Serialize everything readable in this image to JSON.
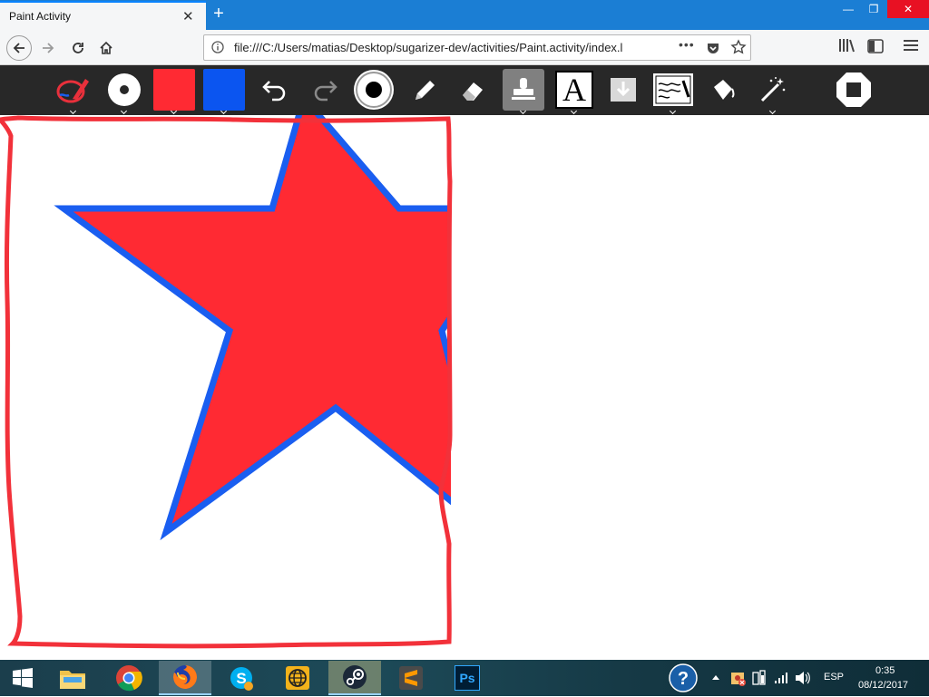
{
  "browser": {
    "tab_title": "Paint Activity",
    "tab_close": "✕",
    "new_tab": "+",
    "url": "file:///C:/Users/matias/Desktop/sugarizer-dev/activities/Paint.activity/index.l",
    "url_more": "•••",
    "window_min": "—",
    "window_max": "❐",
    "window_close": "✕"
  },
  "toolbar": {
    "tools": [
      {
        "name": "activity",
        "icon": "paint-activity-icon"
      },
      {
        "name": "size",
        "icon": "brush-size-icon"
      },
      {
        "name": "fill-color",
        "icon": "color-swatch-icon",
        "color": "#ff2a33"
      },
      {
        "name": "stroke-color",
        "icon": "color-swatch-icon",
        "color": "#0b55f0"
      },
      {
        "name": "undo",
        "icon": "undo-icon"
      },
      {
        "name": "redo",
        "icon": "redo-icon"
      },
      {
        "name": "brush",
        "icon": "brush-icon"
      },
      {
        "name": "pencil",
        "icon": "pencil-icon"
      },
      {
        "name": "eraser",
        "icon": "eraser-icon"
      },
      {
        "name": "stamp",
        "icon": "stamp-icon"
      },
      {
        "name": "text",
        "icon": "text-icon",
        "label": "A"
      },
      {
        "name": "insert-image",
        "icon": "insert-image-icon"
      },
      {
        "name": "background",
        "icon": "background-icon"
      },
      {
        "name": "bucket",
        "icon": "bucket-icon"
      },
      {
        "name": "filters",
        "icon": "magic-wand-icon"
      },
      {
        "name": "stop",
        "icon": "stop-icon"
      }
    ]
  },
  "canvas": {
    "border_color": "#f2313a",
    "star_fill": "#ff2a33",
    "star_stroke": "#1a5ef0"
  },
  "taskbar": {
    "apps": [
      {
        "name": "file-explorer",
        "icon": "folder-icon"
      },
      {
        "name": "chrome",
        "icon": "chrome-icon"
      },
      {
        "name": "firefox",
        "icon": "firefox-icon"
      },
      {
        "name": "skype",
        "icon": "skype-icon"
      },
      {
        "name": "globe",
        "icon": "globe-icon"
      },
      {
        "name": "steam",
        "icon": "steam-icon"
      },
      {
        "name": "sublime",
        "icon": "sublime-icon"
      },
      {
        "name": "photoshop",
        "icon": "photoshop-icon",
        "label": "Ps"
      }
    ],
    "language": "ESP",
    "time": "0:35",
    "date": "08/12/2017"
  }
}
